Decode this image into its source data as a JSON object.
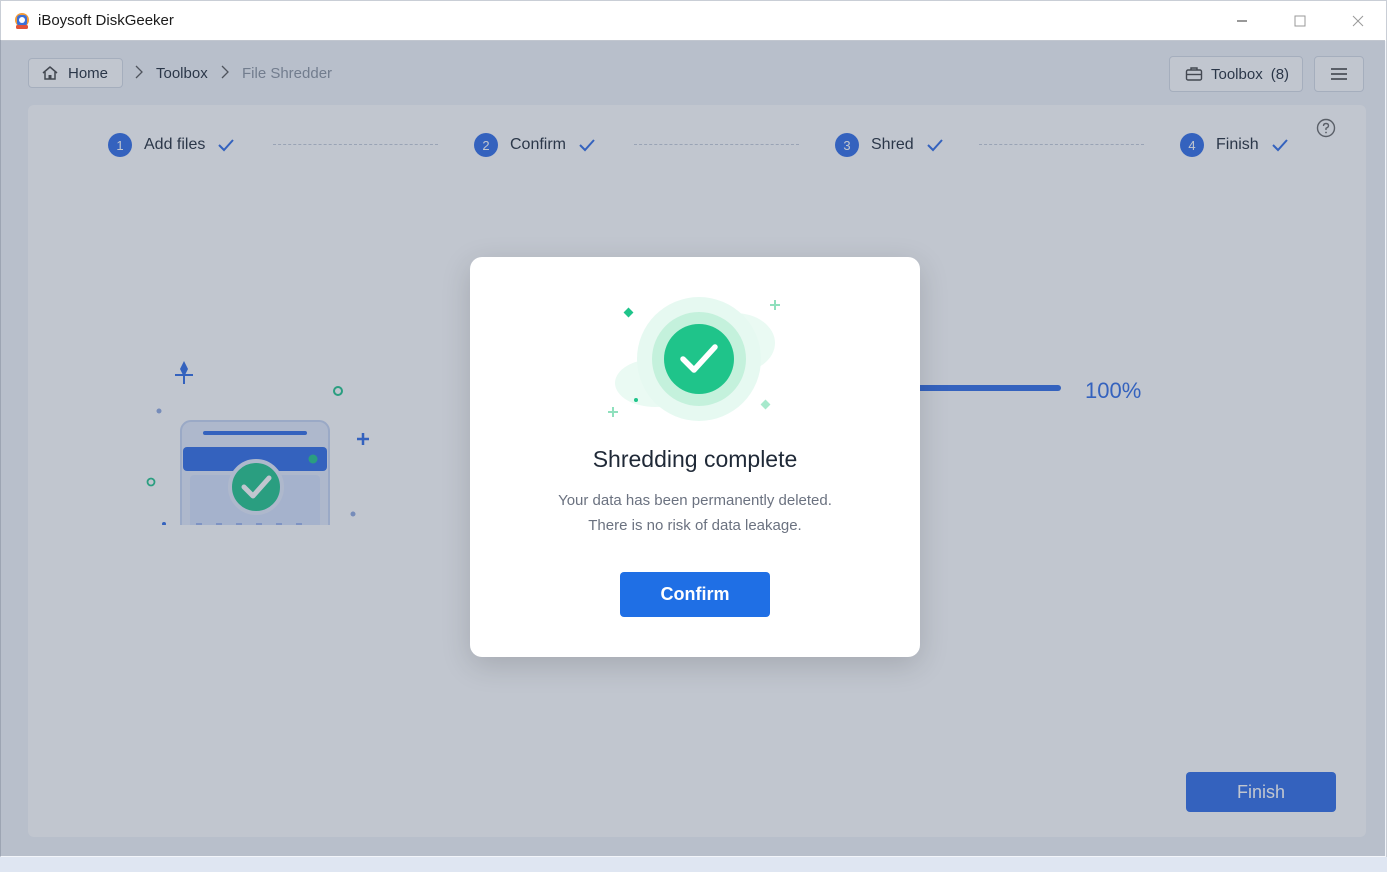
{
  "window": {
    "title": "iBoysoft DiskGeeker"
  },
  "breadcrumb": {
    "home_label": "Home",
    "items": [
      "Toolbox",
      "File Shredder"
    ]
  },
  "toolbar": {
    "toolbox_label": "Toolbox",
    "toolbox_count": "(8)"
  },
  "steps": [
    {
      "number": "1",
      "label": "Add files",
      "done": true
    },
    {
      "number": "2",
      "label": "Confirm",
      "done": true
    },
    {
      "number": "3",
      "label": "Shred",
      "done": true
    },
    {
      "number": "4",
      "label": "Finish",
      "done": true
    }
  ],
  "progress": {
    "value": 1.0,
    "label": "100%"
  },
  "footer": {
    "finish_label": "Finish"
  },
  "dialog": {
    "title": "Shredding complete",
    "line1": "Your data has been permanently deleted.",
    "line2": "There is no risk of data leakage.",
    "confirm_label": "Confirm"
  },
  "colors": {
    "accent": "#2e6be6",
    "success": "#1fc48a"
  }
}
